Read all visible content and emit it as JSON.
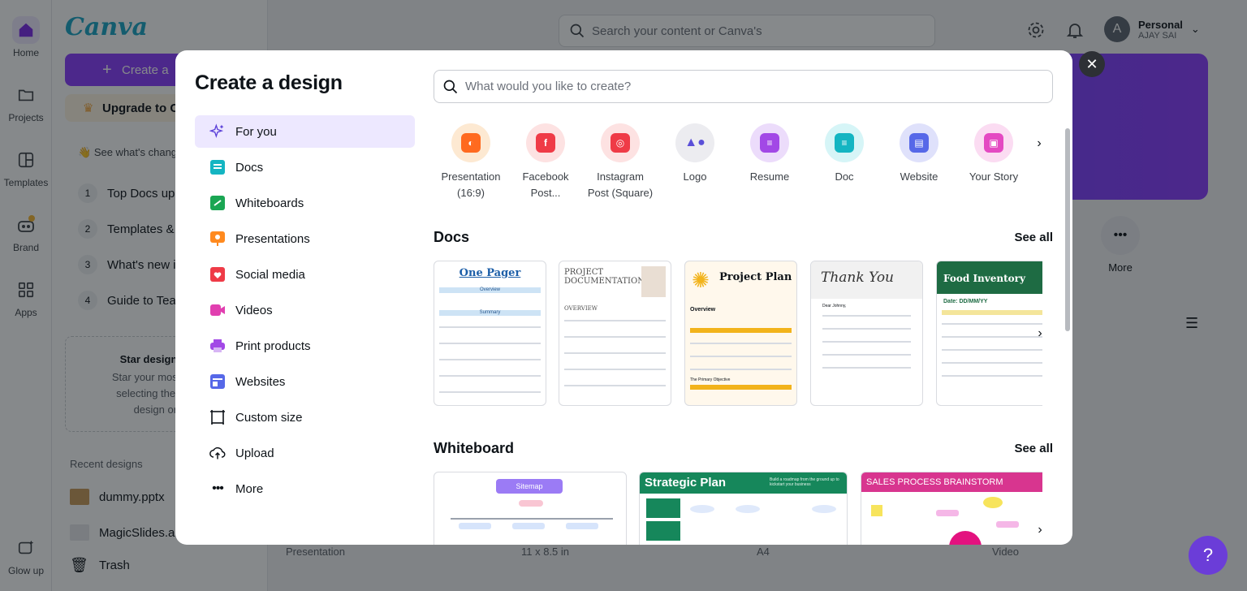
{
  "app": {
    "rail": [
      {
        "label": "Home",
        "icon": "home-icon"
      },
      {
        "label": "Projects",
        "icon": "folder-icon"
      },
      {
        "label": "Templates",
        "icon": "templates-icon"
      },
      {
        "label": "Brand",
        "icon": "brand-icon"
      },
      {
        "label": "Apps",
        "icon": "apps-icon"
      },
      {
        "label": "Glow up",
        "icon": "glow-up-icon"
      }
    ],
    "logo": "Canva",
    "create_button": "Create a",
    "upgrade_button": "Upgrade to C",
    "whats_changing": "See what's chang",
    "guide_items": [
      {
        "num": "1",
        "label": "Top Docs up"
      },
      {
        "num": "2",
        "label": "Templates &"
      },
      {
        "num": "3",
        "label": "What's new i"
      },
      {
        "num": "4",
        "label": "Guide to Tea"
      }
    ],
    "star_box": {
      "title": "Star designs and",
      "line1": "Star your most import",
      "line2": "selecting the ⭐ sta",
      "line3": "design or fol"
    },
    "recent_heading": "Recent designs",
    "recent_items": [
      "dummy.pptx",
      "MagicSlides.a"
    ],
    "trash": "Trash",
    "top_search_placeholder": "Search your content or Canva's",
    "account": {
      "initial": "A",
      "name": "Personal",
      "user": "AJAY SAI"
    },
    "more_label": "More",
    "bottom_labels": [
      "Presentation",
      "11 x 8.5 in",
      "A4",
      "Video"
    ],
    "help": "?"
  },
  "modal": {
    "title": "Create a design",
    "search_placeholder": "What would you like to create?",
    "nav": [
      {
        "label": "For you",
        "icon": "sparkle-icon",
        "active": true
      },
      {
        "label": "Docs",
        "icon": "docs-icon"
      },
      {
        "label": "Whiteboards",
        "icon": "whiteboard-icon"
      },
      {
        "label": "Presentations",
        "icon": "presentation-icon"
      },
      {
        "label": "Social media",
        "icon": "heart-icon"
      },
      {
        "label": "Videos",
        "icon": "video-icon"
      },
      {
        "label": "Print products",
        "icon": "printer-icon"
      },
      {
        "label": "Websites",
        "icon": "website-icon"
      },
      {
        "label": "Custom size",
        "icon": "custom-size-icon"
      },
      {
        "label": "Upload",
        "icon": "upload-icon"
      },
      {
        "label": "More",
        "icon": "more-icon"
      }
    ],
    "design_types": [
      {
        "line1": "Presentation",
        "line2": "(16:9)",
        "icon": "presentation-icon",
        "bg": "#fde9d2",
        "fg": "#ff6a1f"
      },
      {
        "line1": "Facebook",
        "line2": "Post...",
        "icon": "facebook-icon",
        "bg": "#fde2e2",
        "fg": "#ef3b47"
      },
      {
        "line1": "Instagram",
        "line2": "Post (Square)",
        "icon": "instagram-icon",
        "bg": "#fde2e2",
        "fg": "#ef3b47"
      },
      {
        "line1": "Logo",
        "line2": "",
        "icon": "logo-icon",
        "bg": "#ececf0",
        "fg": "#5a4fd8"
      },
      {
        "line1": "Resume",
        "line2": "",
        "icon": "resume-icon",
        "bg": "#ecdcfb",
        "fg": "#a248e6"
      },
      {
        "line1": "Doc",
        "line2": "",
        "icon": "doc-icon",
        "bg": "#d6f5f7",
        "fg": "#14b5c2"
      },
      {
        "line1": "Website",
        "line2": "",
        "icon": "website-icon",
        "bg": "#dfe1fb",
        "fg": "#5668e8"
      },
      {
        "line1": "Your Story",
        "line2": "",
        "icon": "story-icon",
        "bg": "#fbdcf2",
        "fg": "#e449c2"
      }
    ],
    "docs_section": {
      "title": "Docs",
      "see_all": "See all",
      "cards": [
        {
          "title": "One Pager",
          "subtitle": "Overview",
          "table_heading": "Summary"
        },
        {
          "title": "PROJECT DOCUMENTATION",
          "subtitle": "OVERVIEW"
        },
        {
          "title": "Project Plan",
          "subtitle": "Overview",
          "footer": "The Primary Objective"
        },
        {
          "title": "Thank You",
          "subtitle": "Dear Johnny,"
        },
        {
          "title": "Food Inventory",
          "subtitle": "Date: DD/MM/YY"
        }
      ]
    },
    "whiteboard_section": {
      "title": "Whiteboard",
      "see_all": "See all",
      "cards": [
        {
          "title": "Sitemap"
        },
        {
          "title": "Strategic Plan",
          "subtitle": "Build a roadmap from the ground up to kickstart your business"
        },
        {
          "title": "SALES PROCESS BRAINSTORM"
        }
      ]
    }
  }
}
